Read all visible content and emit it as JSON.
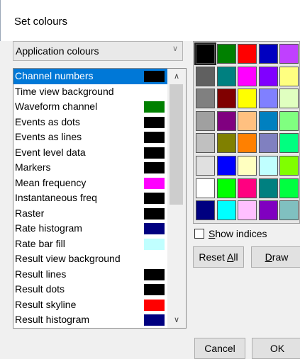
{
  "window": {
    "title": "Set colours"
  },
  "combo": {
    "value": "Application colours"
  },
  "list": {
    "items": [
      {
        "label": "Channel numbers",
        "color": "#000000",
        "selected": true
      },
      {
        "label": "Time view background",
        "color": "#ffffff",
        "selected": false
      },
      {
        "label": "Waveform channel",
        "color": "#008000",
        "selected": false
      },
      {
        "label": "Events as dots",
        "color": "#000000",
        "selected": false
      },
      {
        "label": "Events as lines",
        "color": "#000000",
        "selected": false
      },
      {
        "label": "Event level data",
        "color": "#000000",
        "selected": false
      },
      {
        "label": "Markers",
        "color": "#000000",
        "selected": false
      },
      {
        "label": "Mean frequency",
        "color": "#ff00ff",
        "selected": false
      },
      {
        "label": "Instantaneous freq",
        "color": "#000000",
        "selected": false
      },
      {
        "label": "Raster",
        "color": "#000000",
        "selected": false
      },
      {
        "label": "Rate histogram",
        "color": "#000080",
        "selected": false
      },
      {
        "label": "Rate bar fill",
        "color": "#c0ffff",
        "selected": false
      },
      {
        "label": "Result view background",
        "color": "#ffffff",
        "selected": false
      },
      {
        "label": "Result lines",
        "color": "#000000",
        "selected": false
      },
      {
        "label": "Result dots",
        "color": "#000000",
        "selected": false
      },
      {
        "label": "Result skyline",
        "color": "#ff0000",
        "selected": false
      },
      {
        "label": "Result histogram",
        "color": "#000080",
        "selected": false
      }
    ]
  },
  "palette": {
    "colors": [
      [
        "#000000",
        "#008000",
        "#ff0000",
        "#0000c0",
        "#c040ff"
      ],
      [
        "#606060",
        "#008080",
        "#ff00ff",
        "#8000ff",
        "#ffff80"
      ],
      [
        "#808080",
        "#800000",
        "#ffff00",
        "#8080ff",
        "#e0ffc0"
      ],
      [
        "#a0a0a0",
        "#800080",
        "#ffc080",
        "#0080c0",
        "#80ff80"
      ],
      [
        "#c0c0c0",
        "#808000",
        "#ff8000",
        "#8080c0",
        "#00ff80"
      ],
      [
        "#e0e0e0",
        "#0000ff",
        "#ffffc0",
        "#c0ffff",
        "#80ff00"
      ],
      [
        "#ffffff",
        "#00ff00",
        "#ff0080",
        "#008080",
        "#00ff40"
      ],
      [
        "#000080",
        "#00ffff",
        "#ffc0ff",
        "#8000c0",
        "#80c0c0"
      ]
    ],
    "selected": "#000000"
  },
  "checkbox": {
    "label_prefix": "",
    "label_accel": "S",
    "label_rest": "how indices",
    "checked": false
  },
  "buttons": {
    "reset_prefix": "Reset ",
    "reset_accel": "A",
    "reset_rest": "ll",
    "draw_accel": "D",
    "draw_rest": "raw",
    "cancel": "Cancel",
    "ok": "OK"
  }
}
